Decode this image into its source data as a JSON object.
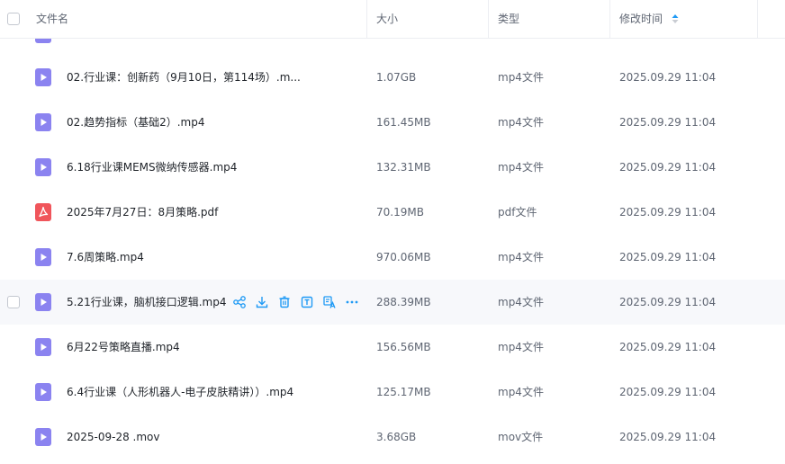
{
  "header": {
    "name_label": "文件名",
    "size_label": "大小",
    "type_label": "类型",
    "time_label": "修改时间"
  },
  "colors": {
    "video_icon": "#8b83f0",
    "pdf_icon": "#f0555b",
    "action_icon": "#1f9af5",
    "sort_active": "#1f9af5"
  },
  "files": [
    {
      "name": "02.行业课：创新药（9月10日，第114场）.m...",
      "size": "1.07GB",
      "type": "mp4文件",
      "time": "2025.09.29 11:04",
      "icon": "video-icon"
    },
    {
      "name": "02.趋势指标（基础2）.mp4",
      "size": "161.45MB",
      "type": "mp4文件",
      "time": "2025.09.29 11:04",
      "icon": "video-icon"
    },
    {
      "name": "6.18行业课MEMS微纳传感器.mp4",
      "size": "132.31MB",
      "type": "mp4文件",
      "time": "2025.09.29 11:04",
      "icon": "video-icon"
    },
    {
      "name": "2025年7月27日：8月策略.pdf",
      "size": "70.19MB",
      "type": "pdf文件",
      "time": "2025.09.29 11:04",
      "icon": "pdf-icon"
    },
    {
      "name": "7.6周策略.mp4",
      "size": "970.06MB",
      "type": "mp4文件",
      "time": "2025.09.29 11:04",
      "icon": "video-icon"
    },
    {
      "name": "5.21行业课，脑机接口逻辑.mp4",
      "size": "288.39MB",
      "type": "mp4文件",
      "time": "2025.09.29 11:04",
      "icon": "video-icon"
    },
    {
      "name": "6月22号策略直播.mp4",
      "size": "156.56MB",
      "type": "mp4文件",
      "time": "2025.09.29 11:04",
      "icon": "video-icon"
    },
    {
      "name": "6.4行业课（人形机器人-电子皮肤精讲））.mp4",
      "size": "125.17MB",
      "type": "mp4文件",
      "time": "2025.09.29 11:04",
      "icon": "video-icon"
    },
    {
      "name": "2025-09-28 .mov",
      "size": "3.68GB",
      "type": "mov文件",
      "time": "2025.09.29 11:04",
      "icon": "video-icon"
    }
  ],
  "row_actions": [
    "share-icon",
    "download-icon",
    "delete-icon",
    "text-extract-icon",
    "translate-icon",
    "more-icon"
  ]
}
